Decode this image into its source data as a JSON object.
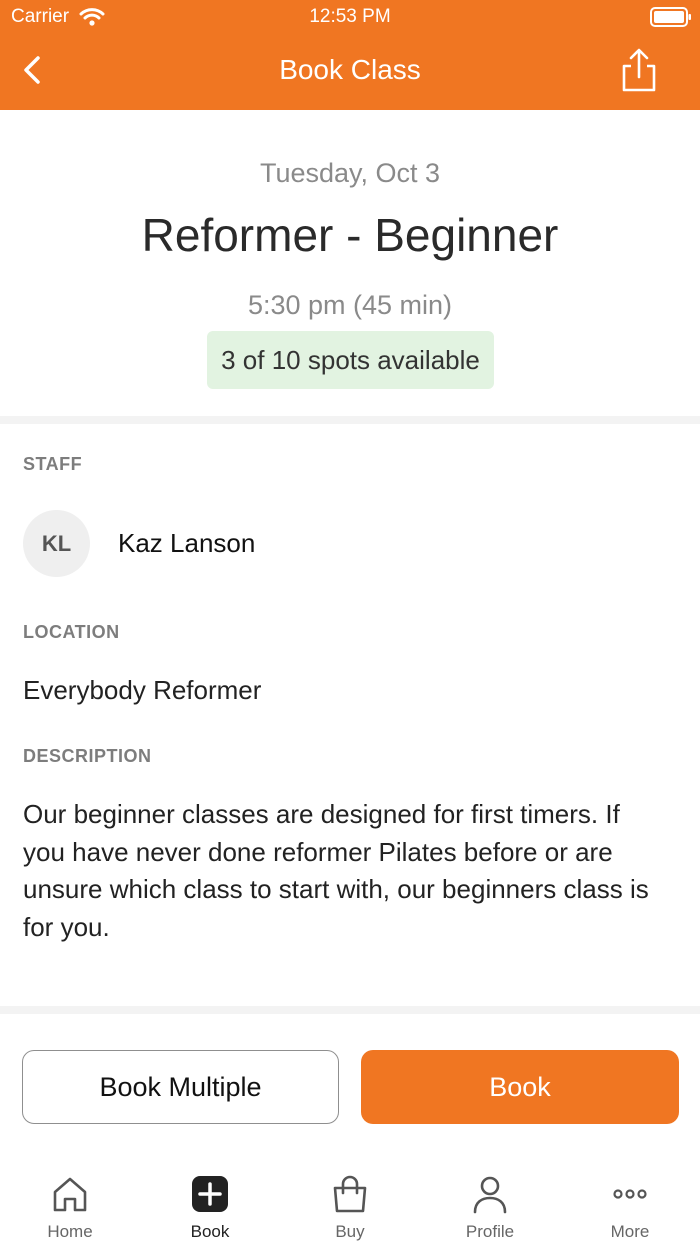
{
  "status_bar": {
    "carrier": "Carrier",
    "time": "12:53 PM"
  },
  "nav": {
    "title": "Book Class",
    "back_icon": "chevron-left-icon",
    "share_icon": "share-icon"
  },
  "class": {
    "date": "Tuesday, Oct 3",
    "title": "Reformer - Beginner",
    "time": "5:30 pm (45 min)",
    "spots": "3 of 10 spots available"
  },
  "staff": {
    "label": "STAFF",
    "initials": "KL",
    "name": "Kaz Lanson"
  },
  "location": {
    "label": "LOCATION",
    "name": "Everybody Reformer"
  },
  "description": {
    "label": "DESCRIPTION",
    "text": "Our beginner classes are designed for first timers. If you have never done reformer Pilates before or are unsure which class to start with, our beginners class is for you."
  },
  "actions": {
    "book_multiple": "Book Multiple",
    "book": "Book"
  },
  "tabs": [
    {
      "label": "Home",
      "icon": "home-icon"
    },
    {
      "label": "Book",
      "icon": "plus-square-icon"
    },
    {
      "label": "Buy",
      "icon": "shopping-bag-icon"
    },
    {
      "label": "Profile",
      "icon": "person-icon"
    },
    {
      "label": "More",
      "icon": "more-dots-icon"
    }
  ],
  "colors": {
    "accent": "#f07622",
    "spots_bg": "#e2f3e1"
  }
}
